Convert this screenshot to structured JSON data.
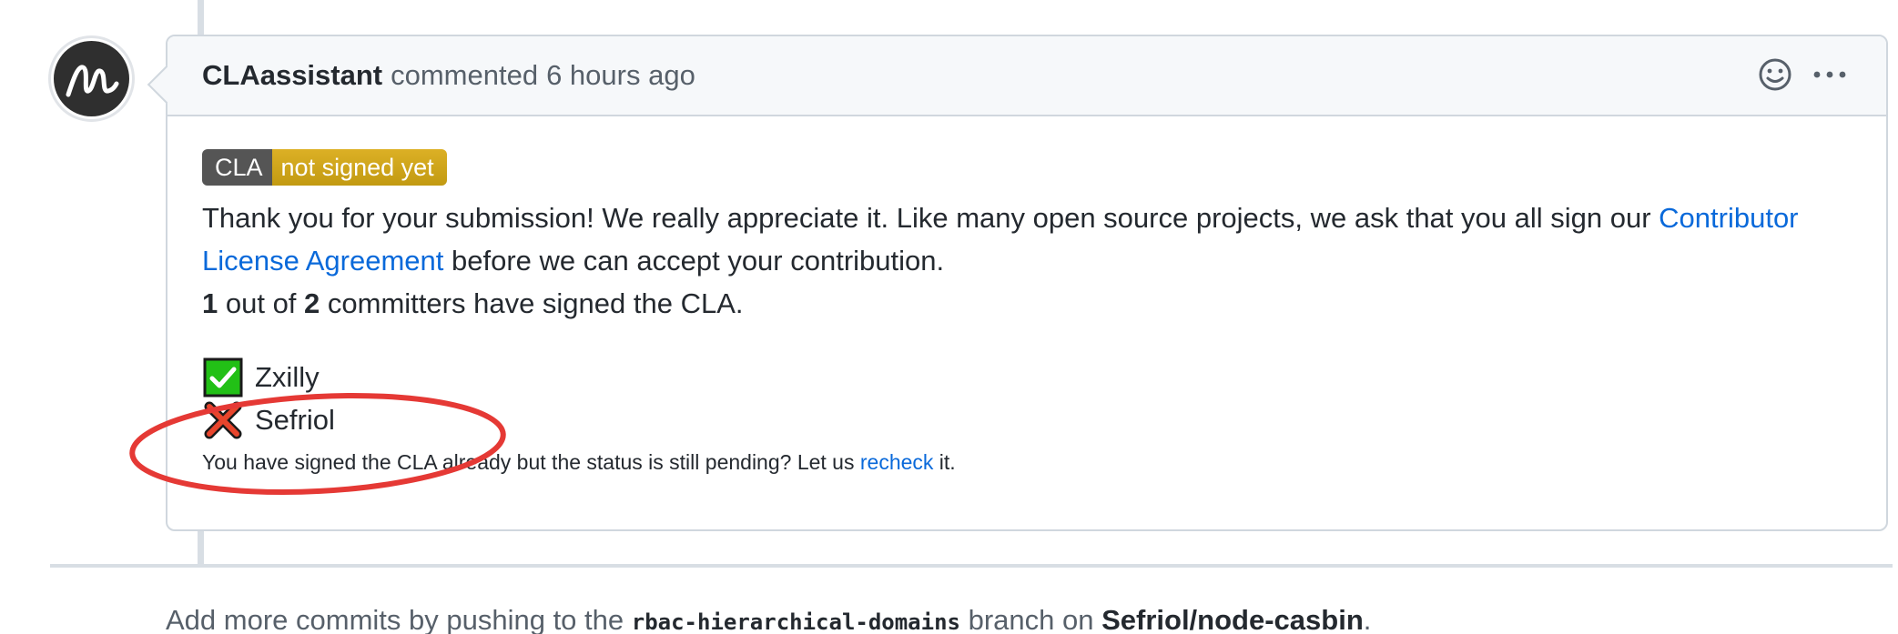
{
  "comment": {
    "author": "CLAassistant",
    "action": "commented",
    "timestamp": "6 hours ago",
    "header_icons": [
      "smiley-icon",
      "kebab-horizontal-icon"
    ],
    "avatar_icon": "scribble-logo-icon",
    "badge": {
      "left": "CLA",
      "right": "not signed yet",
      "left_color": "#555555",
      "right_color": "#d3a51a"
    },
    "message": {
      "intro": "Thank you for your submission! We really appreciate it. Like many open source projects, we ask that you all sign our ",
      "link": "Contributor License Agreement",
      "outro": " before we can accept your contribution."
    },
    "status": {
      "signed": "1",
      "mid": " out of ",
      "total": "2",
      "tail": " committers have signed the CLA."
    },
    "committers": [
      {
        "name": "Zxilly",
        "signed": true,
        "icon": "check-box-icon"
      },
      {
        "name": "Sefriol",
        "signed": false,
        "icon": "cross-icon"
      }
    ],
    "recheck": {
      "before": "You have signed the CLA already but the status is still pending? Let us ",
      "link": "recheck",
      "after": " it."
    }
  },
  "footer": {
    "before": "Add more commits by pushing to the ",
    "branch": "rbac-hierarchical-domains",
    "middle": " branch on ",
    "repo": "Sefriol/node-casbin",
    "after": "."
  },
  "colors": {
    "link": "#0969da",
    "annotation": "#e53935",
    "check_bg": "#22c016",
    "cross": "#e8452c"
  }
}
